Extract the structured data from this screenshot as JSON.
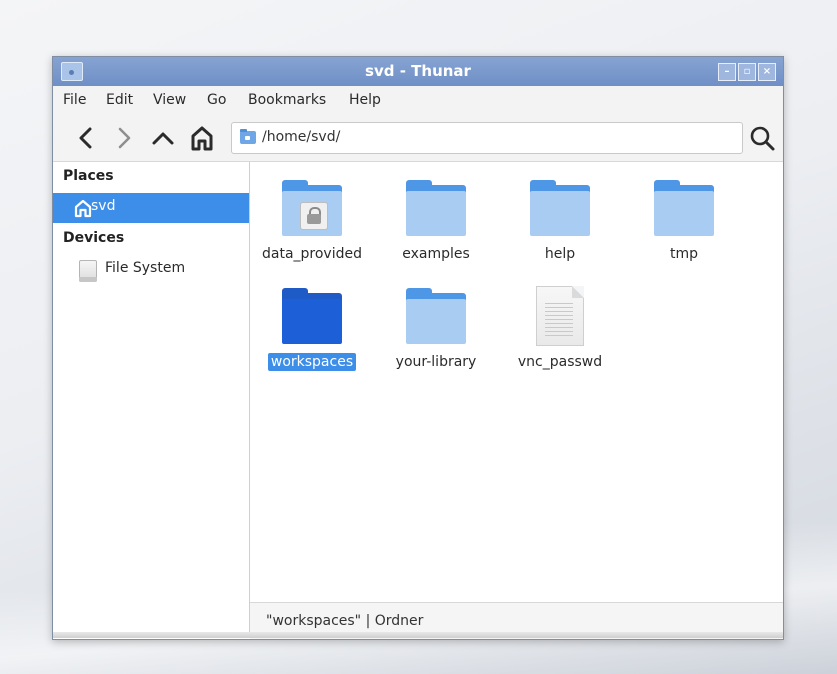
{
  "window": {
    "title": "svd - Thunar",
    "controls": {
      "minimize": "–",
      "maximize": "▫",
      "close": "×"
    }
  },
  "menubar": {
    "items": [
      "File",
      "Edit",
      "View",
      "Go",
      "Bookmarks",
      "Help"
    ]
  },
  "toolbar": {
    "location_path": "/home/svd/"
  },
  "sidebar": {
    "places_heading": "Places",
    "places_items": [
      {
        "label": "svd",
        "icon": "home-icon",
        "selected": true
      }
    ],
    "devices_heading": "Devices",
    "devices_items": [
      {
        "label": "File System",
        "icon": "drive-icon"
      }
    ]
  },
  "files": [
    {
      "label": "data_provided",
      "type": "folder",
      "locked": true
    },
    {
      "label": "examples",
      "type": "folder"
    },
    {
      "label": "help",
      "type": "folder"
    },
    {
      "label": "tmp",
      "type": "folder"
    },
    {
      "label": "workspaces",
      "type": "folder",
      "selected": true
    },
    {
      "label": "your-library",
      "type": "folder"
    },
    {
      "label": "vnc_passwd",
      "type": "file"
    }
  ],
  "statusbar": {
    "text": "\"workspaces\" | Ordner"
  },
  "colors": {
    "accent": "#3d8ee8",
    "titlebar": "#7893c8",
    "folder_light": "#a8ccf2",
    "folder_selected": "#1d5fd6"
  }
}
